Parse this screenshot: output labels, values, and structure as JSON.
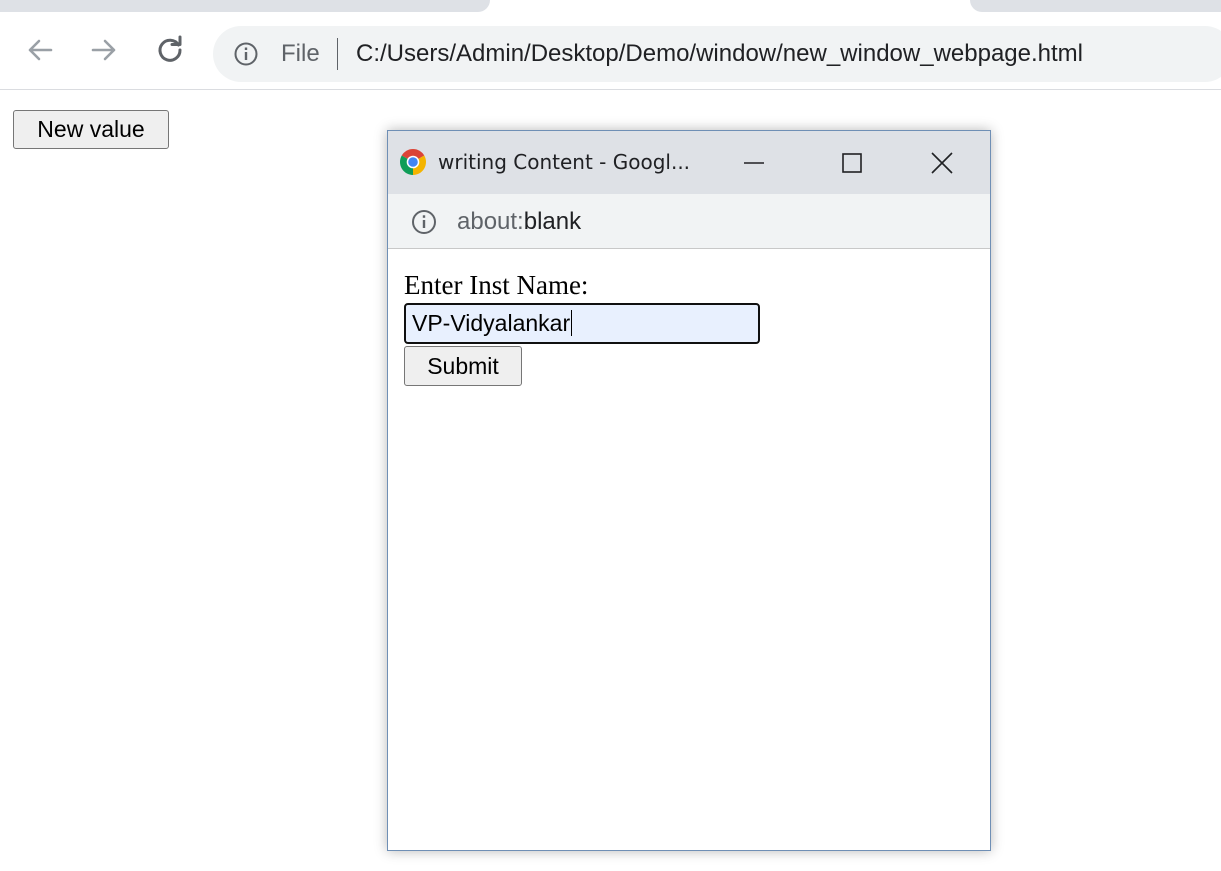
{
  "browser": {
    "omnibox": {
      "scheme_chip": "File",
      "url": "C:/Users/Admin/Desktop/Demo/window/new_window_webpage.html"
    }
  },
  "page": {
    "new_value_button": "New value"
  },
  "popup": {
    "title": "writing Content - Googl...",
    "address": {
      "scheme": "about:",
      "host": "blank"
    },
    "form": {
      "label": "Enter Inst Name:",
      "input_value": "VP-Vidyalankar",
      "submit_label": "Submit"
    }
  },
  "icons": {
    "back": "back-arrow-icon",
    "forward": "forward-arrow-icon",
    "reload": "reload-icon",
    "info": "info-icon",
    "chrome": "chrome-logo-icon",
    "minimize": "minimize-icon",
    "maximize": "maximize-icon",
    "close": "close-icon"
  },
  "colors": {
    "chrome_frame": "#dee1e6",
    "omnibox_bg": "#f1f3f4",
    "autofill_bg": "#e8f0fe",
    "popup_border": "#6f8fb5"
  }
}
